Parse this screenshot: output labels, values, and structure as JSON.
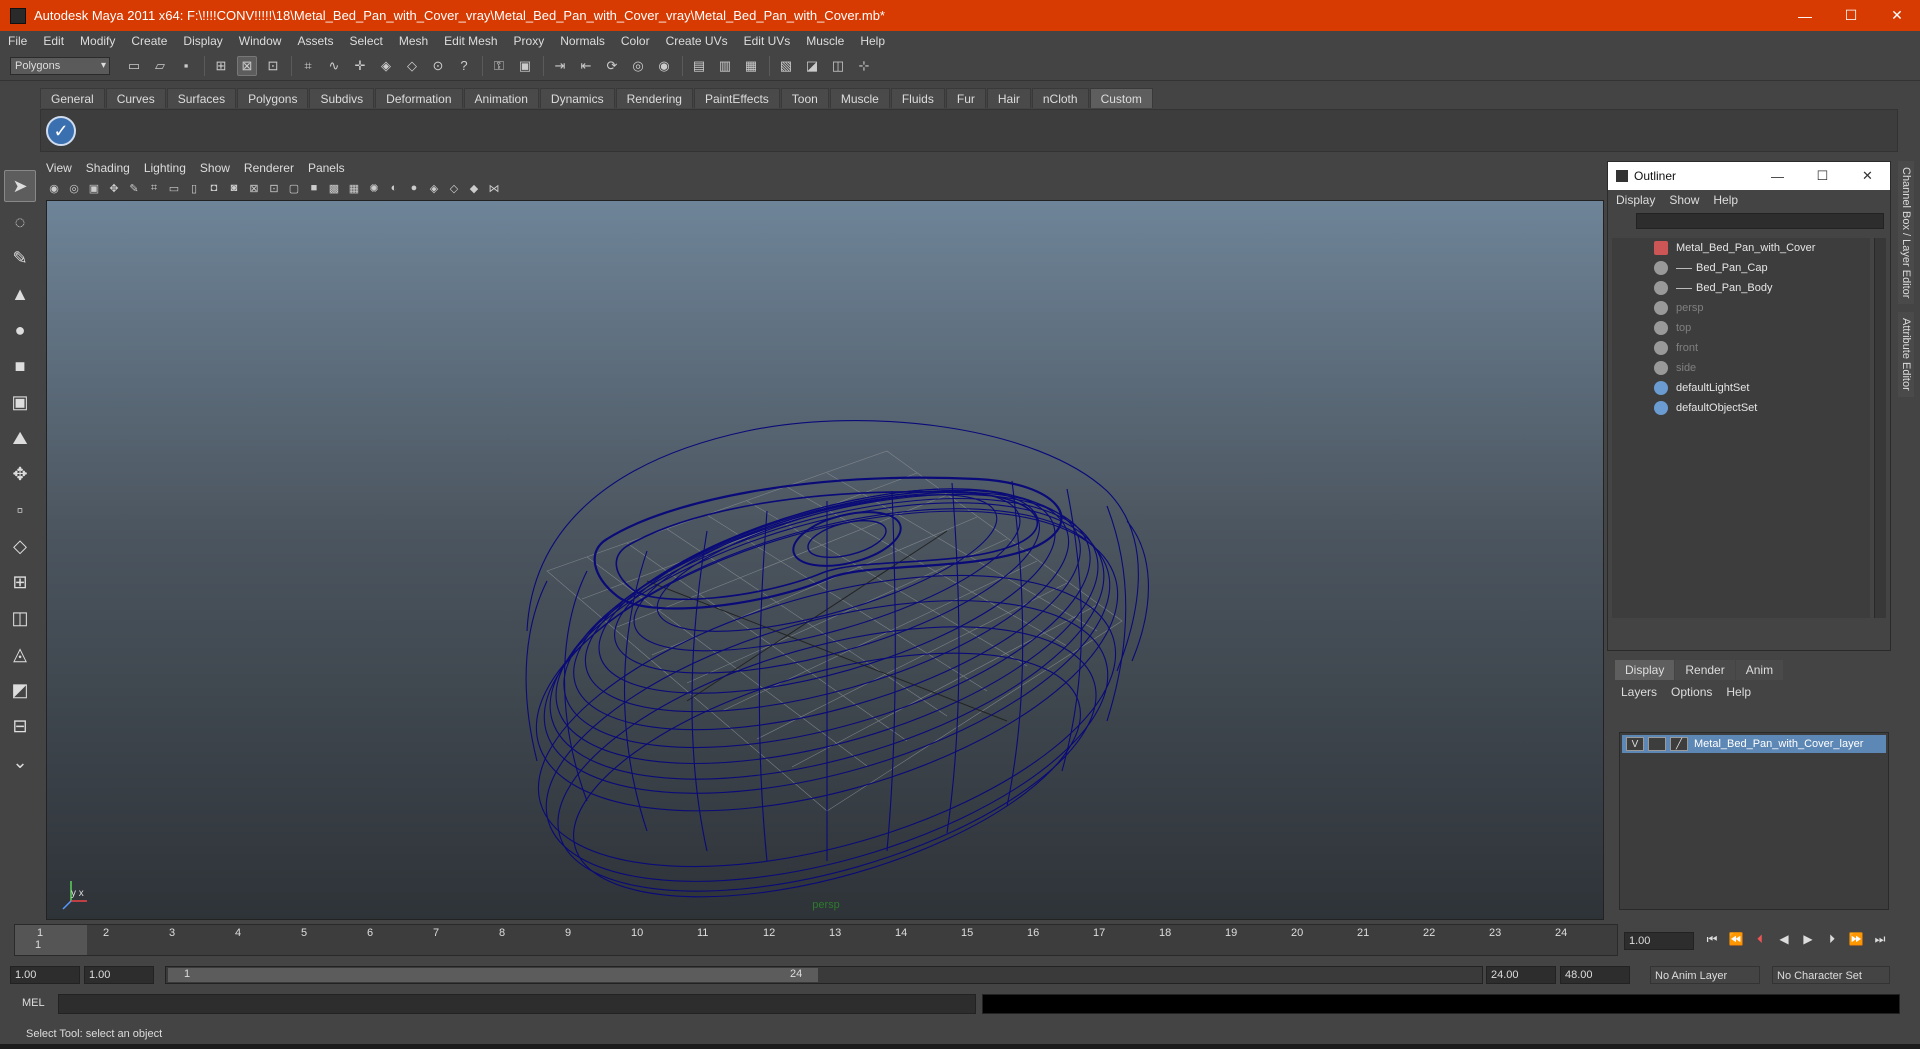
{
  "window": {
    "title": "Autodesk Maya 2011 x64: F:\\!!!!CONV!!!!!\\18\\Metal_Bed_Pan_with_Cover_vray\\Metal_Bed_Pan_with_Cover_vray\\Metal_Bed_Pan_with_Cover.mb*",
    "minimize": "—",
    "maximize": "☐",
    "close": "✕"
  },
  "menu": [
    "File",
    "Edit",
    "Modify",
    "Create",
    "Display",
    "Window",
    "Assets",
    "Select",
    "Mesh",
    "Edit Mesh",
    "Proxy",
    "Normals",
    "Color",
    "Create UVs",
    "Edit UVs",
    "Muscle",
    "Help"
  ],
  "status_line": {
    "mode": "Polygons"
  },
  "shelf": {
    "tabs": [
      "General",
      "Curves",
      "Surfaces",
      "Polygons",
      "Subdivs",
      "Deformation",
      "Animation",
      "Dynamics",
      "Rendering",
      "PaintEffects",
      "Toon",
      "Muscle",
      "Fluids",
      "Fur",
      "Hair",
      "nCloth",
      "Custom"
    ],
    "active_tab": "Custom",
    "button_icon": "checkmark-icon"
  },
  "panel": {
    "menu": [
      "View",
      "Shading",
      "Lighting",
      "Show",
      "Renderer",
      "Panels"
    ],
    "camera": "persp",
    "axis_y": "y",
    "axis_x": "x",
    "wire_color": "#0a0a78"
  },
  "outliner": {
    "title": "Outliner",
    "menu": [
      "Display",
      "Show",
      "Help"
    ],
    "items": [
      {
        "label": "Metal_Bed_Pan_with_Cover",
        "level": 0,
        "dim": false
      },
      {
        "label": "Bed_Pan_Cap",
        "level": 1,
        "dim": false
      },
      {
        "label": "Bed_Pan_Body",
        "level": 1,
        "dim": false
      },
      {
        "label": "persp",
        "level": 0,
        "dim": true
      },
      {
        "label": "top",
        "level": 0,
        "dim": true
      },
      {
        "label": "front",
        "level": 0,
        "dim": true
      },
      {
        "label": "side",
        "level": 0,
        "dim": true
      },
      {
        "label": "defaultLightSet",
        "level": 0,
        "dim": false
      },
      {
        "label": "defaultObjectSet",
        "level": 0,
        "dim": false
      }
    ]
  },
  "layers": {
    "tabs": [
      "Display",
      "Render",
      "Anim"
    ],
    "active_tab": "Display",
    "menu": [
      "Layers",
      "Options",
      "Help"
    ],
    "row": {
      "visible": "V",
      "name": "Metal_Bed_Pan_with_Cover_layer"
    }
  },
  "side_tabs": [
    "Channel Box / Layer Editor",
    "Attribute Editor"
  ],
  "time_slider": {
    "ticks": [
      "1",
      "2",
      "3",
      "4",
      "5",
      "6",
      "7",
      "8",
      "9",
      "10",
      "11",
      "12",
      "13",
      "14",
      "15",
      "16",
      "17",
      "18",
      "19",
      "20",
      "21",
      "22",
      "23",
      "24"
    ],
    "current_marker": "1",
    "current_frame": "1.00"
  },
  "range_slider": {
    "start": "1.00",
    "anim_start": "1.00",
    "range_start": "1",
    "range_end": "24",
    "playback_end": "24.00",
    "anim_end": "48.00",
    "anim_layer": "No Anim Layer",
    "character_set": "No Character Set"
  },
  "command_line": {
    "label": "MEL"
  },
  "help_line": "Select Tool: select an object"
}
